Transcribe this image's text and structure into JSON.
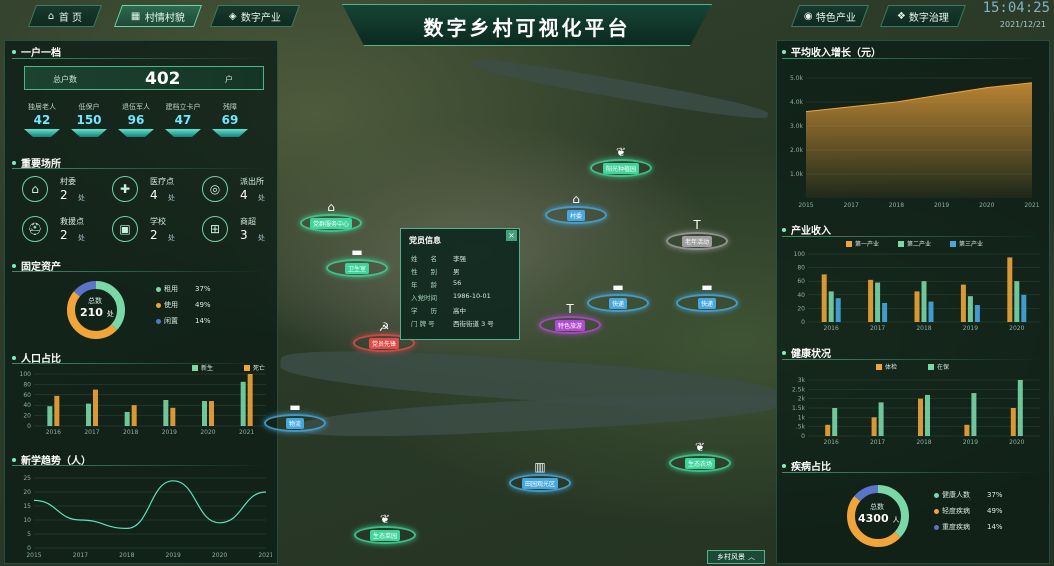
{
  "header": {
    "nav_left": [
      {
        "label": "首 页",
        "icon": "home-icon"
      },
      {
        "label": "村情村貌",
        "icon": "village-icon"
      },
      {
        "label": "数字产业",
        "icon": "box-icon"
      }
    ],
    "title": "数字乡村可视化平台",
    "nav_right": [
      {
        "label": "特色产业",
        "icon": "wifi-icon"
      },
      {
        "label": "数字治理",
        "icon": "governance-icon"
      }
    ],
    "clock": "15:04:25",
    "date": "2021/12/21"
  },
  "left": {
    "household": {
      "title": "一户一档",
      "total_label": "总户数",
      "total_value": "402",
      "total_unit": "户",
      "stats": [
        {
          "label": "独居老人",
          "value": "42"
        },
        {
          "label": "低保户",
          "value": "150"
        },
        {
          "label": "退伍军人",
          "value": "96"
        },
        {
          "label": "建档立卡户",
          "value": "47"
        },
        {
          "label": "残障",
          "value": "69"
        }
      ]
    },
    "facilities": {
      "title": "重要场所",
      "items": [
        {
          "name": "村委",
          "value": "2",
          "unit": "处",
          "icon": "building-icon"
        },
        {
          "name": "医疗点",
          "value": "4",
          "unit": "处",
          "icon": "medical-icon"
        },
        {
          "name": "派出所",
          "value": "4",
          "unit": "处",
          "icon": "police-icon"
        },
        {
          "name": "救援点",
          "value": "2",
          "unit": "处",
          "icon": "rescue-icon"
        },
        {
          "name": "学校",
          "value": "2",
          "unit": "处",
          "icon": "school-icon"
        },
        {
          "name": "商超",
          "value": "3",
          "unit": "处",
          "icon": "shop-icon"
        }
      ]
    },
    "assets": {
      "title": "固定资产",
      "center_label": "总数",
      "center_value": "210",
      "center_unit": "处",
      "legend": [
        {
          "label": "租用",
          "pct": "37%",
          "color": "#7ad8a8"
        },
        {
          "label": "使用",
          "pct": "49%",
          "color": "#f0a43a"
        },
        {
          "label": "闲置",
          "pct": "14%",
          "color": "#5a74c9"
        }
      ]
    },
    "population": {
      "title": "人口占比"
    },
    "birth": {
      "title": "新学趋势（人）"
    }
  },
  "right": {
    "income": {
      "title": "平均收入增长（元）"
    },
    "industry": {
      "title": "产业收入"
    },
    "health": {
      "title": "健康状况"
    },
    "disease": {
      "title": "疾病占比",
      "center_label": "总数",
      "center_value": "4300",
      "center_unit": "人",
      "legend": [
        {
          "label": "健康人数",
          "pct": "37%",
          "color": "#7ad8a8"
        },
        {
          "label": "轻度疾病",
          "pct": "49%",
          "color": "#f0a43a"
        },
        {
          "label": "重度疾病",
          "pct": "14%",
          "color": "#5a74c9"
        }
      ]
    }
  },
  "popup": {
    "title": "党员信息",
    "close": "×",
    "rows": [
      {
        "k": "姓　　名",
        "v": "李强"
      },
      {
        "k": "性　　别",
        "v": "男"
      },
      {
        "k": "年　　龄",
        "v": "56"
      },
      {
        "k": "入党时间",
        "v": "1986-10-01"
      },
      {
        "k": "学　　历",
        "v": "高中"
      },
      {
        "k": "门 牌 号",
        "v": "西街街道 3 号"
      }
    ]
  },
  "markers": [
    {
      "label": "党群服务中心",
      "color": "#3fd49a",
      "icon": "bank-icon"
    },
    {
      "label": "卫生室",
      "color": "#3fd49a",
      "icon": "truck-icon"
    },
    {
      "label": "党员先锋",
      "color": "#e14a4a",
      "icon": "party-icon"
    },
    {
      "label": "村委",
      "color": "#47a8e0",
      "icon": "house-icon"
    },
    {
      "label": "阳光种植园",
      "color": "#3fd49a",
      "icon": "leaf-icon"
    },
    {
      "label": "特色旅游",
      "color": "#b04ad0",
      "icon": "tower-icon"
    },
    {
      "label": "老年活动",
      "color": "#a0a0a0",
      "icon": "tower-icon"
    },
    {
      "label": "快递",
      "color": "#47a8e0",
      "icon": "truck-icon"
    },
    {
      "label": "快递",
      "color": "#47a8e0",
      "icon": "truck-icon"
    },
    {
      "label": "田园观光区",
      "color": "#47a8e0",
      "icon": "trash-icon"
    },
    {
      "label": "生态农场",
      "color": "#3fd49a",
      "icon": "leaf-icon"
    },
    {
      "label": "生态菜园",
      "color": "#3fd49a",
      "icon": "leaf-icon"
    },
    {
      "label": "物流",
      "color": "#47a8e0",
      "icon": "truck-icon"
    }
  ],
  "footer": {
    "label": "乡村风景"
  },
  "chart_data": [
    {
      "type": "bar",
      "title": "人口占比",
      "categories": [
        "2016",
        "2017",
        "2018",
        "2019",
        "2020",
        "2021"
      ],
      "series": [
        {
          "name": "新生",
          "color": "#7ad8a8",
          "values": [
            38,
            43,
            27,
            50,
            48,
            85
          ]
        },
        {
          "name": "死亡",
          "color": "#f0a43a",
          "values": [
            58,
            70,
            40,
            35,
            48,
            100
          ]
        }
      ],
      "ylim": [
        0,
        100
      ],
      "yticks": [
        0,
        20,
        40,
        60,
        80,
        100
      ]
    },
    {
      "type": "line",
      "title": "新学趋势（人）",
      "x": [
        "2015",
        "2017",
        "2018",
        "2019",
        "2020",
        "2021"
      ],
      "values": [
        17,
        10,
        7,
        24,
        9,
        20
      ],
      "ylim": [
        0,
        25
      ],
      "yticks": [
        0,
        5,
        10,
        15,
        20,
        25
      ]
    },
    {
      "type": "area",
      "title": "平均收入增长（元）",
      "x": [
        "2015",
        "2017",
        "2018",
        "2019",
        "2020",
        "2021"
      ],
      "values": [
        3.6,
        3.8,
        4.0,
        4.3,
        4.6,
        4.8
      ],
      "ylim": [
        0,
        5
      ],
      "yticks": [
        {
          "v": 1,
          "label": "1.0k"
        },
        {
          "v": 2,
          "label": "2.0k"
        },
        {
          "v": 3,
          "label": "3.0k"
        },
        {
          "v": 4,
          "label": "4.0k"
        },
        {
          "v": 5,
          "label": "5.0k"
        }
      ],
      "color": "#f0a43a"
    },
    {
      "type": "bar",
      "title": "产业收入",
      "categories": [
        "2016",
        "2017",
        "2018",
        "2019",
        "2020"
      ],
      "series": [
        {
          "name": "第一产业",
          "color": "#f0a43a",
          "values": [
            70,
            62,
            45,
            55,
            95
          ]
        },
        {
          "name": "第二产业",
          "color": "#7ad8a8",
          "values": [
            45,
            58,
            60,
            38,
            60
          ]
        },
        {
          "name": "第三产业",
          "color": "#47a8e0",
          "values": [
            35,
            28,
            30,
            25,
            40
          ]
        }
      ],
      "ylim": [
        0,
        100
      ],
      "yticks": [
        0,
        20,
        40,
        60,
        80,
        100
      ]
    },
    {
      "type": "bar",
      "title": "健康状况",
      "categories": [
        "2016",
        "2017",
        "2018",
        "2019",
        "2020"
      ],
      "series": [
        {
          "name": "体检",
          "color": "#f0a43a",
          "values": [
            0.6,
            1.0,
            2.0,
            0.6,
            1.5
          ]
        },
        {
          "name": "在保",
          "color": "#7ad8a8",
          "values": [
            1.5,
            1.8,
            2.2,
            2.3,
            3.0
          ]
        }
      ],
      "ylim": [
        0,
        3
      ],
      "yticks": [
        {
          "v": 0,
          "label": "0"
        },
        {
          "v": 0.5,
          "label": ".5k"
        },
        {
          "v": 1,
          "label": "1k"
        },
        {
          "v": 1.5,
          "label": "1.5k"
        },
        {
          "v": 2,
          "label": "2k"
        },
        {
          "v": 2.5,
          "label": "2.5k"
        },
        {
          "v": 3,
          "label": "3k"
        }
      ]
    }
  ]
}
